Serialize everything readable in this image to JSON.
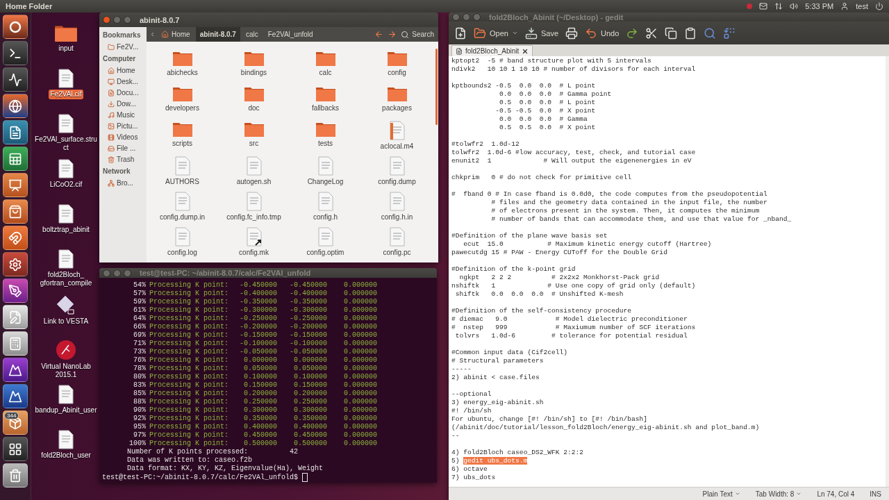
{
  "top_bar": {
    "title": "Home Folder",
    "time": "5:33 PM",
    "user": "test"
  },
  "launcher": [
    {
      "kind": "dash"
    },
    {
      "kind": "terminal"
    },
    {
      "kind": "monitor"
    },
    {
      "kind": "browser"
    },
    {
      "kind": "writer"
    },
    {
      "kind": "spreadsheet"
    },
    {
      "kind": "presentation"
    },
    {
      "kind": "store"
    },
    {
      "kind": "magnet"
    },
    {
      "kind": "settings"
    },
    {
      "kind": "draw"
    },
    {
      "kind": "editor"
    },
    {
      "kind": "calculator"
    },
    {
      "kind": "plot"
    },
    {
      "kind": "plot-blue"
    },
    {
      "kind": "package",
      "badge": "344"
    },
    {
      "kind": "workspaces"
    },
    {
      "kind": "trash"
    }
  ],
  "desktop_icons": [
    {
      "label": "input",
      "kind": "folder",
      "selected": false
    },
    {
      "label": "Fe2VAl.cif",
      "kind": "file",
      "selected": true
    },
    {
      "label": "Fe2VAl_surface.struct",
      "kind": "file",
      "selected": false
    },
    {
      "label": "LiCoO2.cif",
      "kind": "file",
      "selected": false
    },
    {
      "label": "boltztrap_abinit",
      "kind": "file",
      "selected": false
    },
    {
      "label": "fold2Bloch_ gfortran_compile",
      "kind": "file",
      "selected": false
    },
    {
      "label": "Link to VESTA",
      "kind": "link",
      "selected": false
    },
    {
      "label": "Virtual NanoLab 2015.1",
      "kind": "app",
      "selected": false
    },
    {
      "label": "bandup_Abinit_user",
      "kind": "file",
      "selected": false
    },
    {
      "label": "fold2Bloch_user",
      "kind": "file",
      "selected": false
    }
  ],
  "file_manager": {
    "title": "abinit-8.0.7",
    "active": true,
    "sidebar": [
      {
        "heading": "Bookmarks",
        "items": [
          {
            "label": "Fe2V...",
            "kind": "folder"
          }
        ]
      },
      {
        "heading": "Computer",
        "items": [
          {
            "label": "Home",
            "kind": "home"
          },
          {
            "label": "Desk...",
            "kind": "desktop"
          },
          {
            "label": "Docu...",
            "kind": "documents"
          },
          {
            "label": "Dow...",
            "kind": "downloads"
          },
          {
            "label": "Music",
            "kind": "music"
          },
          {
            "label": "Pictu...",
            "kind": "pictures"
          },
          {
            "label": "Videos",
            "kind": "videos"
          },
          {
            "label": "File ...",
            "kind": "drive"
          },
          {
            "label": "Trash",
            "kind": "trash"
          }
        ]
      },
      {
        "heading": "Network",
        "items": [
          {
            "label": "Bro...",
            "kind": "network"
          }
        ]
      }
    ],
    "breadcrumbs": [
      {
        "label": "Home",
        "kind": "home",
        "selected": false
      },
      {
        "label": "abinit-8.0.7",
        "kind": "folder",
        "selected": true
      },
      {
        "label": "calc",
        "kind": "folder",
        "selected": false
      },
      {
        "label": "Fe2VAl_unfold",
        "kind": "folder",
        "selected": false
      }
    ],
    "search_label": "Search",
    "files": [
      {
        "name": "abichecks",
        "kind": "folder"
      },
      {
        "name": "bindings",
        "kind": "folder"
      },
      {
        "name": "calc",
        "kind": "folder"
      },
      {
        "name": "config",
        "kind": "folder"
      },
      {
        "name": "developers",
        "kind": "folder"
      },
      {
        "name": "doc",
        "kind": "folder"
      },
      {
        "name": "fallbacks",
        "kind": "folder"
      },
      {
        "name": "packages",
        "kind": "folder"
      },
      {
        "name": "scripts",
        "kind": "folder"
      },
      {
        "name": "src",
        "kind": "folder"
      },
      {
        "name": "tests",
        "kind": "folder"
      },
      {
        "name": "aclocal.m4",
        "kind": "macro"
      },
      {
        "name": "AUTHORS",
        "kind": "file"
      },
      {
        "name": "autogen.sh",
        "kind": "file"
      },
      {
        "name": "ChangeLog",
        "kind": "file"
      },
      {
        "name": "config.dump",
        "kind": "file"
      },
      {
        "name": "config.dump.in",
        "kind": "file"
      },
      {
        "name": "config.fc_info.tmp",
        "kind": "file"
      },
      {
        "name": "config.h",
        "kind": "file"
      },
      {
        "name": "config.h.in",
        "kind": "file"
      },
      {
        "name": "config.log",
        "kind": "file"
      },
      {
        "name": "config.mk",
        "kind": "symlink"
      },
      {
        "name": "config.optim",
        "kind": "file"
      },
      {
        "name": "config.pc",
        "kind": "file"
      }
    ]
  },
  "terminal": {
    "title": "test@test-PC: ~/abinit-8.0.7/calc/Fe2VAl_unfold",
    "active": false,
    "progress_rows": [
      {
        "percent": "54%",
        "label": "Processing K point:",
        "kx": "-0.450000",
        "ky": "-0.450000",
        "kz": "0.000000"
      },
      {
        "percent": "57%",
        "label": "Processing K point:",
        "kx": "-0.400000",
        "ky": "-0.400000",
        "kz": "0.000000"
      },
      {
        "percent": "59%",
        "label": "Processing K point:",
        "kx": "-0.350000",
        "ky": "-0.350000",
        "kz": "0.000000"
      },
      {
        "percent": "61%",
        "label": "Processing K point:",
        "kx": "-0.300000",
        "ky": "-0.300000",
        "kz": "0.000000"
      },
      {
        "percent": "64%",
        "label": "Processing K point:",
        "kx": "-0.250000",
        "ky": "-0.250000",
        "kz": "0.000000"
      },
      {
        "percent": "66%",
        "label": "Processing K point:",
        "kx": "-0.200000",
        "ky": "-0.200000",
        "kz": "0.000000"
      },
      {
        "percent": "69%",
        "label": "Processing K point:",
        "kx": "-0.150000",
        "ky": "-0.150000",
        "kz": "0.000000"
      },
      {
        "percent": "71%",
        "label": "Processing K point:",
        "kx": "-0.100000",
        "ky": "-0.100000",
        "kz": "0.000000"
      },
      {
        "percent": "73%",
        "label": "Processing K point:",
        "kx": "-0.050000",
        "ky": "-0.050000",
        "kz": "0.000000"
      },
      {
        "percent": "76%",
        "label": "Processing K point:",
        "kx": "0.000000",
        "ky": "0.000000",
        "kz": "0.000000"
      },
      {
        "percent": "78%",
        "label": "Processing K point:",
        "kx": "0.050000",
        "ky": "0.050000",
        "kz": "0.000000"
      },
      {
        "percent": "80%",
        "label": "Processing K point:",
        "kx": "0.100000",
        "ky": "0.100000",
        "kz": "0.000000"
      },
      {
        "percent": "83%",
        "label": "Processing K point:",
        "kx": "0.150000",
        "ky": "0.150000",
        "kz": "0.000000"
      },
      {
        "percent": "85%",
        "label": "Processing K point:",
        "kx": "0.200000",
        "ky": "0.200000",
        "kz": "0.000000"
      },
      {
        "percent": "88%",
        "label": "Processing K point:",
        "kx": "0.250000",
        "ky": "0.250000",
        "kz": "0.000000"
      },
      {
        "percent": "90%",
        "label": "Processing K point:",
        "kx": "0.300000",
        "ky": "0.300000",
        "kz": "0.000000"
      },
      {
        "percent": "92%",
        "label": "Processing K point:",
        "kx": "0.350000",
        "ky": "0.350000",
        "kz": "0.000000"
      },
      {
        "percent": "95%",
        "label": "Processing K point:",
        "kx": "0.400000",
        "ky": "0.400000",
        "kz": "0.000000"
      },
      {
        "percent": "97%",
        "label": "Processing K point:",
        "kx": "0.450000",
        "ky": "0.450000",
        "kz": "0.000000"
      },
      {
        "percent": "100%",
        "label": "Processing K point:",
        "kx": "0.500000",
        "ky": "0.500000",
        "kz": "0.000000"
      }
    ],
    "output_lines": [
      "Number of K points processed:          42",
      "Data was written to: caseo.f2b",
      "Data format: KX, KY, KZ, Eigenvalue(Ha), Weight"
    ],
    "prompt": "test@test-PC:~/abinit-8.0.7/calc/Fe2VAl_unfold$"
  },
  "editor": {
    "title": "fold2Bloch_Abinit (~/Desktop) - gedit",
    "active": false,
    "toolbar": [
      {
        "kind": "new"
      },
      {
        "kind": "open",
        "label": "Open"
      },
      {
        "kind": "save",
        "label": "Save"
      },
      {
        "kind": "print"
      },
      {
        "kind": "undo",
        "label": "Undo"
      },
      {
        "kind": "redo"
      },
      {
        "kind": "cut"
      },
      {
        "kind": "copy"
      },
      {
        "kind": "paste"
      },
      {
        "kind": "find"
      },
      {
        "kind": "replace"
      }
    ],
    "tab": {
      "label": "fold2Bloch_Abinit"
    },
    "blocks": [
      [
        "kptopt2  -5 # band structure plot with 5 intervals",
        "ndivk2   10 10 1 10 10 # number of divisors for each interval"
      ],
      [
        "kptbounds2 -0.5  0.0  0.0  # L point",
        "            0.0  0.0  0.0  # Gamma point",
        "            0.5  0.0  0.0  # L point",
        "           -0.5 -0.5  0.0  # X point",
        "            0.0  0.0  0.0  # Gamma",
        "            0.5  0.5  0.0  # X point"
      ],
      [
        "#tolwfr2  1.0d-12",
        "tolwfr2  1.0d-6 #low accuracy, test, check, and tutorial case",
        "enunit2  1             # Will output the eigenenergies in eV"
      ],
      [
        "chkprim   0 # do not check for primitive cell"
      ],
      [
        "#  fband 0 # In case fband is 0.0d0, the code computes from the pseudopotential",
        "          # files and the geometry data contained in the input file, the number",
        "          # of electrons present in the system. Then, it computes the minimum",
        "          # number of bands that can accommodate them, and use that value for _nband_"
      ],
      [
        "#Definition of the plane wave basis set",
        "   ecut  15.0           # Maximum kinetic energy cutoff (Hartree)",
        "pawecutdg 15 # PAW - Energy CUToff for the Double Grid"
      ],
      [
        "#Definition of the k-point grid",
        "  ngkpt   2 2 2          # 2x2x2 Monkhorst-Pack grid",
        "nshiftk   1             # Use one copy of grid only (default)",
        " shiftk   0.0  0.0  0.0  # Unshifted K-mesh"
      ],
      [
        "#Definition of the self-consistency procedure",
        "# diemac   9.0            # Model dielectric preconditioner",
        "#  nstep   999            # Maxiumum number of SCF iterations",
        " tolvrs   1.0d-6         # tolerance for potential residual"
      ],
      [
        "#Common input data (Cif2cell)",
        "# Structural parameters",
        "-----",
        "2) abinit < case.files"
      ],
      [
        "--optional",
        "3) energy_eig-abinit.sh",
        "#! /bin/sh",
        "For ubuntu, change [#! /bin/sh] to [#! /bin/bash]",
        "(/abinit/doc/tutorial/lesson_fold2Bloch/energy_eig-abinit.sh and plot_band.m)",
        "--"
      ],
      [
        "4) fold2Bloch caseo_DS2_WFK 2:2:2",
        {
          "kind": "selection",
          "prefix": "5) ",
          "selected_text": "gedit ubs_dots.m"
        },
        "6) octave",
        "7) ubs_dots"
      ]
    ],
    "status_bar": [
      {
        "label": "Plain Text",
        "kind": "menu"
      },
      {
        "label": "Tab Width: 8",
        "kind": "menu"
      },
      {
        "label": "Ln 74, Col 4",
        "kind": "text"
      },
      {
        "label": "INS",
        "kind": "text"
      }
    ]
  }
}
